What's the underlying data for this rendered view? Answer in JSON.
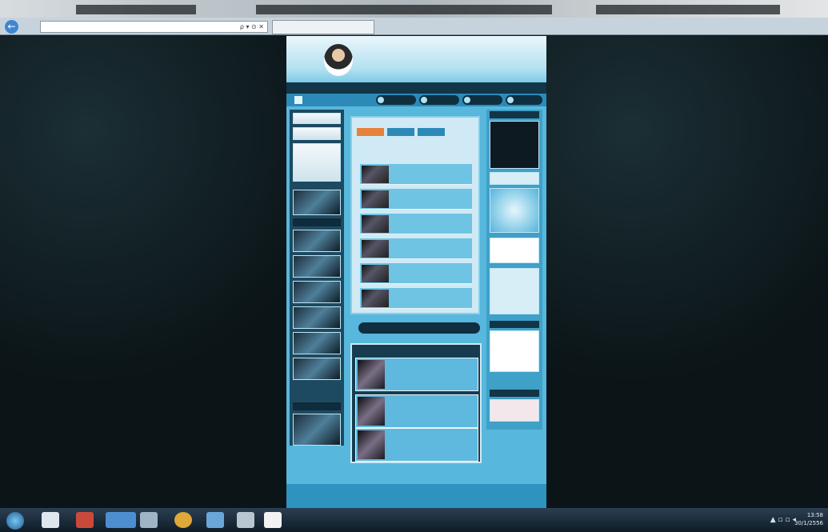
{
  "browser": {
    "address": "",
    "tab_title": "",
    "address_controls": "ρ ▾ ⊙ ✕"
  },
  "site": {
    "logo_text": "",
    "logo_sub": "",
    "title_text": "",
    "nav_items": [
      "",
      "",
      "",
      ""
    ],
    "center_tabs": [
      "",
      "",
      ""
    ],
    "news_header": "",
    "news": [
      "",
      "",
      "",
      "",
      "",
      ""
    ],
    "section_title": "",
    "bottom_items": [
      "",
      "",
      ""
    ],
    "right_label_top": "",
    "right_label_mid": "",
    "right_label_bottom": "",
    "footer": ""
  },
  "taskbar": {
    "tray": "▲ ▫ ▫ ◂",
    "clock_time": "13:58",
    "clock_date": "30/1/2556"
  },
  "colors": {
    "site_bg": "#57b7dc",
    "accent_orange": "#e6742e",
    "dark_bar": "#123547"
  }
}
